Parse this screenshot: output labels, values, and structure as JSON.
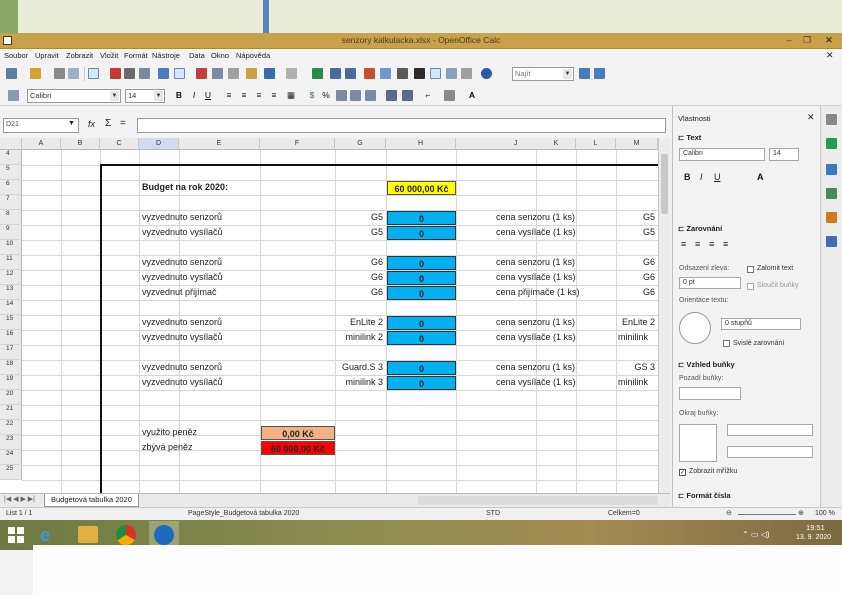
{
  "window": {
    "title": "senzory kalkulacka.xlsx - OpenOffice Calc"
  },
  "menu": [
    "Soubor",
    "Upravit",
    "Zobrazit",
    "Vložit",
    "Formát",
    "Nástroje",
    "Data",
    "Okno",
    "Nápověda"
  ],
  "toolbar": {
    "find_placeholder": "Najít",
    "font_name": "Calibri",
    "font_size": "14"
  },
  "formula": {
    "cell_ref": "D21"
  },
  "columns": [
    "A",
    "B",
    "C",
    "D",
    "E",
    "F",
    "G",
    "H",
    "J",
    "K",
    "L",
    "M"
  ],
  "rows": [
    "4",
    "5",
    "6",
    "7",
    "8",
    "9",
    "10",
    "11",
    "12",
    "13",
    "14",
    "15",
    "16",
    "17",
    "18",
    "19",
    "20",
    "21",
    "22",
    "23",
    "24",
    "25"
  ],
  "sheet": {
    "budget_label": "Budget na rok 2020:",
    "budget_value": "60 000,00 Kč",
    "r8": {
      "label": "vyzvednuto senzorů",
      "model": "G5",
      "val": "0",
      "price_label": "cena senzoru (1 ks)",
      "model2": "G5"
    },
    "r9": {
      "label": "vyzvednuto vysílačů",
      "model": "G5",
      "val": "0",
      "price_label": "cena vysílače (1 ks)",
      "model2": "G5"
    },
    "r11": {
      "label": "vyzvednuto senzorů",
      "model": "G6",
      "val": "0",
      "price_label": "cena senzoru (1 ks)",
      "model2": "G6"
    },
    "r12": {
      "label": "vyzvednuto vysílačů",
      "model": "G6",
      "val": "0",
      "price_label": "cena vysílače (1 ks)",
      "model2": "G6"
    },
    "r13": {
      "label": "vyzvednut přijímač",
      "model": "G6",
      "val": "0",
      "price_label": "cena přijímače (1 ks)",
      "model2": "G6"
    },
    "r15": {
      "label": "vyzvednuto senzorů",
      "model": "EnLite 2",
      "val": "0",
      "price_label": "cena senzoru (1 ks)",
      "model2": "EnLite 2"
    },
    "r16": {
      "label": "vyzvednuto vysílačů",
      "model": "minilink 2",
      "val": "0",
      "price_label": "cena vysílače (1 ks)",
      "model2": "minilink"
    },
    "r18": {
      "label": "vyzvednuto senzorů",
      "model": "Guard.S 3",
      "val": "0",
      "price_label": "cena senzoru (1 ks)",
      "model2": "GS 3"
    },
    "r19": {
      "label": "vyzvednuto vysílačů",
      "model": "minilink 3",
      "val": "0",
      "price_label": "cena vysílače (1 ks)",
      "model2": "minilink"
    },
    "used_label": "využito peněz",
    "used_value": "0,00 Kč",
    "remaining_label": "zbývá peněz",
    "remaining_value": "60 000,00 Kč"
  },
  "tab": "Budgetová tabulka 2020",
  "status": {
    "sheet": "List 1 / 1",
    "page_style": "PageStyle_Budgetová tabulka 2020",
    "mode": "STD",
    "sum": "Celkem=0",
    "zoom": "100 %"
  },
  "sidebar": {
    "title": "Vlastnosti",
    "text_section": "Text",
    "font": "Calibri",
    "size": "14",
    "align_section": "Zarovnání",
    "indent_label": "Odsazení zleva:",
    "indent_value": "0 pt",
    "wrap_label": "Zalomit text",
    "merge_label": "Sloučit buňky",
    "orient_label": "Orientace textu:",
    "degrees": "0 stupňů",
    "vertical_label": "Svislé zarovnání",
    "cell_section": "Vzhled buňky",
    "bg_label": "Pozadí buňky:",
    "border_label": "Okraj buňky:",
    "gridlines_label": "Zobrazit mřížku",
    "number_section": "Formát čísla"
  },
  "taskbar": {
    "time": "19:51",
    "date": "13. 9. 2020"
  },
  "colors": {
    "budget_bg": "#ffff00",
    "value_bg": "#00b0f0",
    "used_bg": "#f4b183",
    "remaining_bg": "#ff0000"
  }
}
